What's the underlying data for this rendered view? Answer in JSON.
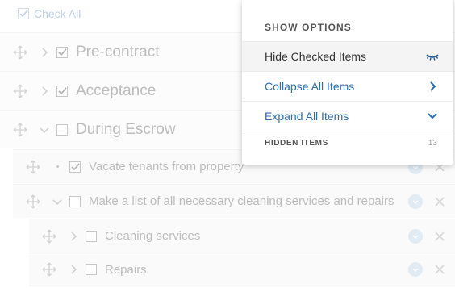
{
  "toolbar": {
    "check_all_label": "Check All"
  },
  "items": [
    {
      "label": "Pre-contract",
      "level": 0,
      "checked": true,
      "expanded": false
    },
    {
      "label": "Acceptance",
      "level": 0,
      "checked": true,
      "expanded": false
    },
    {
      "label": "During Escrow",
      "level": 0,
      "checked": false,
      "expanded": true
    },
    {
      "label": "Vacate tenants from property",
      "level": 1,
      "checked": true,
      "leaf": true
    },
    {
      "label": "Make a list of all necessary cleaning services and repairs",
      "level": 1,
      "checked": false,
      "expanded": true
    },
    {
      "label": "Cleaning services",
      "level": 2,
      "checked": false,
      "expanded": false
    },
    {
      "label": "Repairs",
      "level": 2,
      "checked": false,
      "expanded": false
    }
  ],
  "dropdown": {
    "title": "SHOW OPTIONS",
    "options": [
      {
        "label": "Hide Checked Items",
        "icon": "eye-closed-icon",
        "active": true
      },
      {
        "label": "Collapse All Items",
        "icon": "chevron-right-icon",
        "active": false
      },
      {
        "label": "Expand All Items",
        "icon": "chevron-down-icon",
        "active": false
      }
    ],
    "hidden_items_label": "HIDDEN ITEMS",
    "hidden_items_count": "13"
  },
  "colors": {
    "accent": "#2a6fb0",
    "muted_text": "#9a9a9a",
    "circle_button": "#cfe0ef"
  }
}
